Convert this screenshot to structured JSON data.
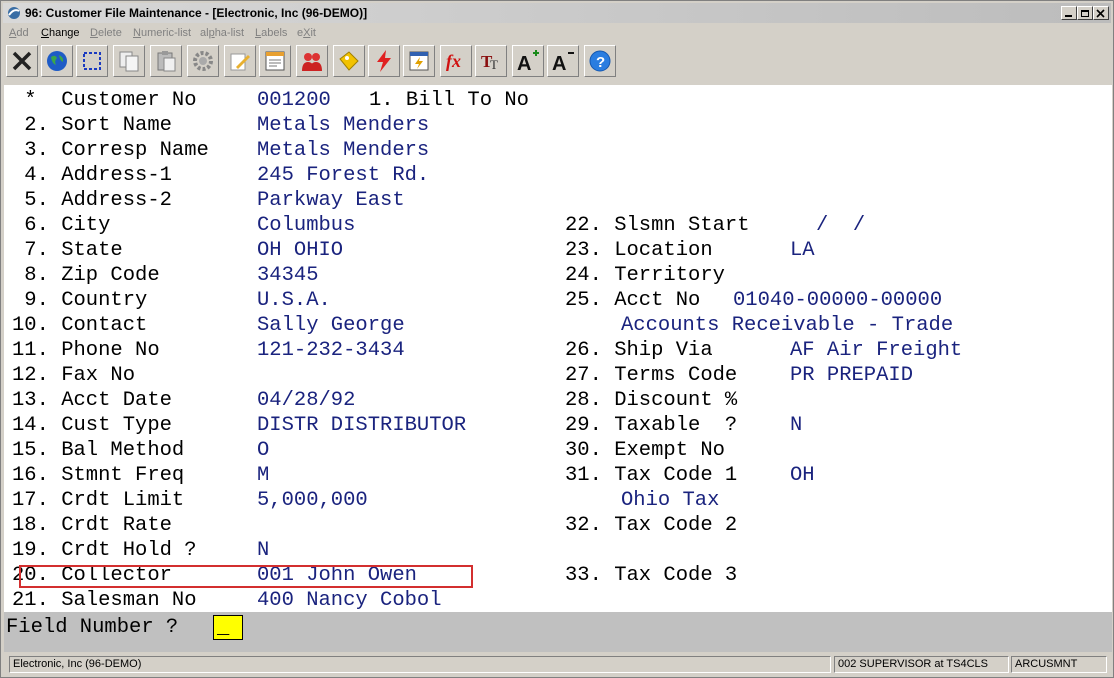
{
  "window": {
    "title": "96: Customer File Maintenance - [Electronic, Inc (96-DEMO)]"
  },
  "menu": [
    {
      "mnemonic": "A",
      "rest": "dd",
      "enabled": false
    },
    {
      "mnemonic": "C",
      "rest": "hange",
      "enabled": true
    },
    {
      "mnemonic": "D",
      "rest": "elete",
      "enabled": false
    },
    {
      "mnemonic": "N",
      "rest": "umeric-list",
      "enabled": false
    },
    {
      "pre": "al",
      "mnemonic": "p",
      "rest": "ha-list",
      "enabled": false
    },
    {
      "mnemonic": "L",
      "rest": "abels",
      "enabled": false
    },
    {
      "pre": "e",
      "mnemonic": "X",
      "rest": "it",
      "enabled": false
    }
  ],
  "toolbar": [
    "close-icon",
    "globe-icon",
    "select-icon",
    "copy-icon",
    "paste-icon",
    "settings-icon",
    "edit-icon",
    "notepad-icon",
    "users-icon",
    "tag-icon",
    "lightning-icon",
    "run-icon",
    "function-icon",
    "font-style-icon",
    "font-larger-icon",
    "font-smaller-icon",
    "help-icon"
  ],
  "left_fields": [
    {
      "label": " *  Customer No",
      "value": "001200"
    },
    {
      "label": " 2. Sort Name",
      "value": "Metals Menders"
    },
    {
      "label": " 3. Corresp Name",
      "value": "Metals Menders"
    },
    {
      "label": " 4. Address-1",
      "value": "245 Forest Rd."
    },
    {
      "label": " 5. Address-2",
      "value": "Parkway East"
    },
    {
      "label": " 6. City",
      "value": "Columbus"
    },
    {
      "label": " 7. State",
      "value": "OH OHIO"
    },
    {
      "label": " 8. Zip Code",
      "value": "34345"
    },
    {
      "label": " 9. Country",
      "value": "U.S.A."
    },
    {
      "label": "10. Contact",
      "value": "Sally George"
    },
    {
      "label": "11. Phone No",
      "value": "121-232-3434"
    },
    {
      "label": "12. Fax No",
      "value": ""
    },
    {
      "label": "13. Acct Date",
      "value": "04/28/92"
    },
    {
      "label": "14. Cust Type",
      "value": "DISTR DISTRIBUTOR"
    },
    {
      "label": "15. Bal Method",
      "value": "O"
    },
    {
      "label": "16. Stmnt Freq",
      "value": "M"
    },
    {
      "label": "17. Crdt Limit",
      "value": "5,000,000"
    },
    {
      "label": "18. Crdt Rate",
      "value": ""
    },
    {
      "label": "19. Crdt Hold ?",
      "value": "N"
    },
    {
      "label": "20. Collector",
      "value": "001 John Owen"
    },
    {
      "label": "21. Salesman No",
      "value": "400 Nancy Cobol"
    }
  ],
  "bill_to": {
    "label": "1. Bill To No",
    "value": ""
  },
  "right_fields": {
    "f22": {
      "label": "22. Slsmn Start",
      "value": "/  /"
    },
    "f23": {
      "label": "23. Location",
      "value": "LA"
    },
    "f24": {
      "label": "24. Territory",
      "value": ""
    },
    "f25": {
      "label": "25. Acct No",
      "value": "01040-00000-00000",
      "desc": "Accounts Receivable - Trade"
    },
    "f26": {
      "label": "26. Ship Via",
      "value": "AF Air Freight"
    },
    "f27": {
      "label": "27. Terms Code",
      "value": "PR PREPAID"
    },
    "f28": {
      "label": "28. Discount %",
      "value": ""
    },
    "f29": {
      "label": "29. Taxable  ?",
      "value": "N"
    },
    "f30": {
      "label": "30. Exempt No",
      "value": ""
    },
    "f31": {
      "label": "31. Tax Code 1",
      "value": "OH",
      "desc": "Ohio Tax"
    },
    "f32": {
      "label": "32. Tax Code 2",
      "value": ""
    },
    "f33": {
      "label": "33. Tax Code 3",
      "value": ""
    }
  },
  "prompt": {
    "label": "Field Number ?",
    "input": "_"
  },
  "status": {
    "company": "Electronic, Inc (96-DEMO)",
    "user": "002 SUPERVISOR at TS4CLS",
    "program": "ARCUSMNT"
  }
}
